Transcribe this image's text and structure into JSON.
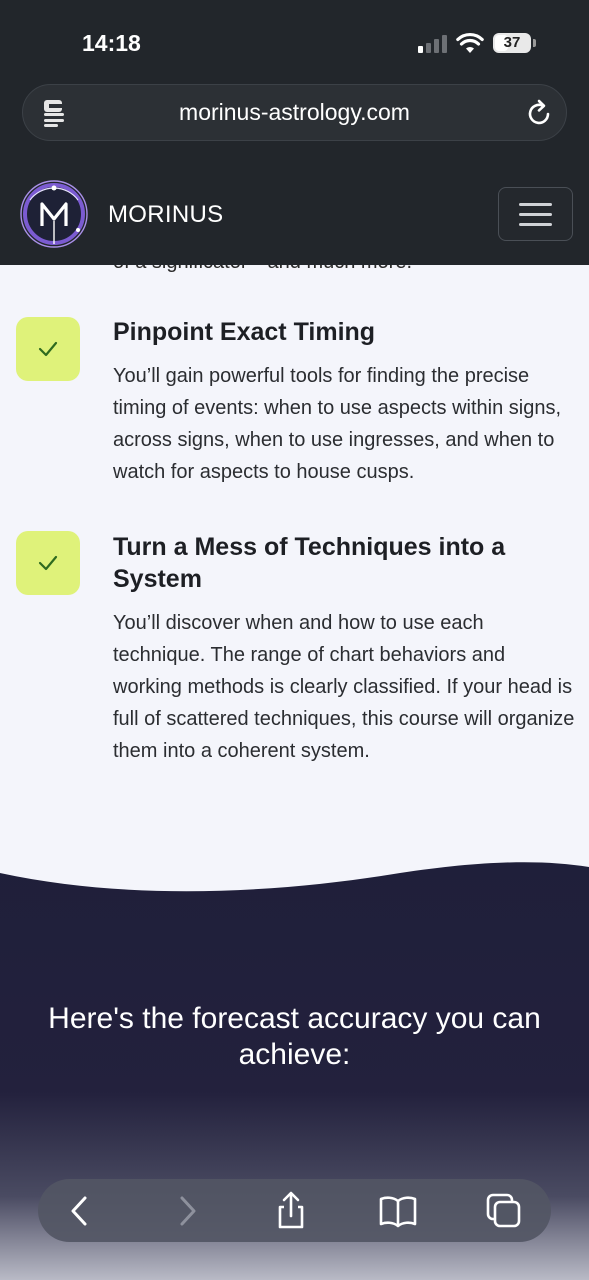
{
  "status_bar": {
    "time": "14:18",
    "battery": "37",
    "battery_level": 0.37
  },
  "browser": {
    "url": "morinus-astrology.com"
  },
  "site": {
    "brand": "MORINUS"
  },
  "content": {
    "clipped_line": "of a significator—and much more.",
    "features": [
      {
        "title": "Pinpoint Exact Timing",
        "desc": "You’ll gain powerful tools for finding the precise timing of events: when to use aspects within signs, across signs, when to use ingresses, and when to watch for aspects to house cusps."
      },
      {
        "title": "Turn a Mess of Techniques into a System",
        "desc": "You’ll discover when and how to use each technique. The range of chart behaviors and working methods is clearly classified. If your head is full of scattered techniques, this course will organize them into a coherent system."
      }
    ]
  },
  "forecast": {
    "title": "Here's the forecast accuracy you can achieve:"
  },
  "colors": {
    "chrome": "#22262b",
    "check_bg": "#dff27a",
    "check_mark": "#2f6b1f",
    "dark_section": "#1f1f3a"
  },
  "toolbar": {
    "icons": [
      "back-icon",
      "forward-icon",
      "share-icon",
      "bookmarks-icon",
      "tabs-icon"
    ]
  }
}
